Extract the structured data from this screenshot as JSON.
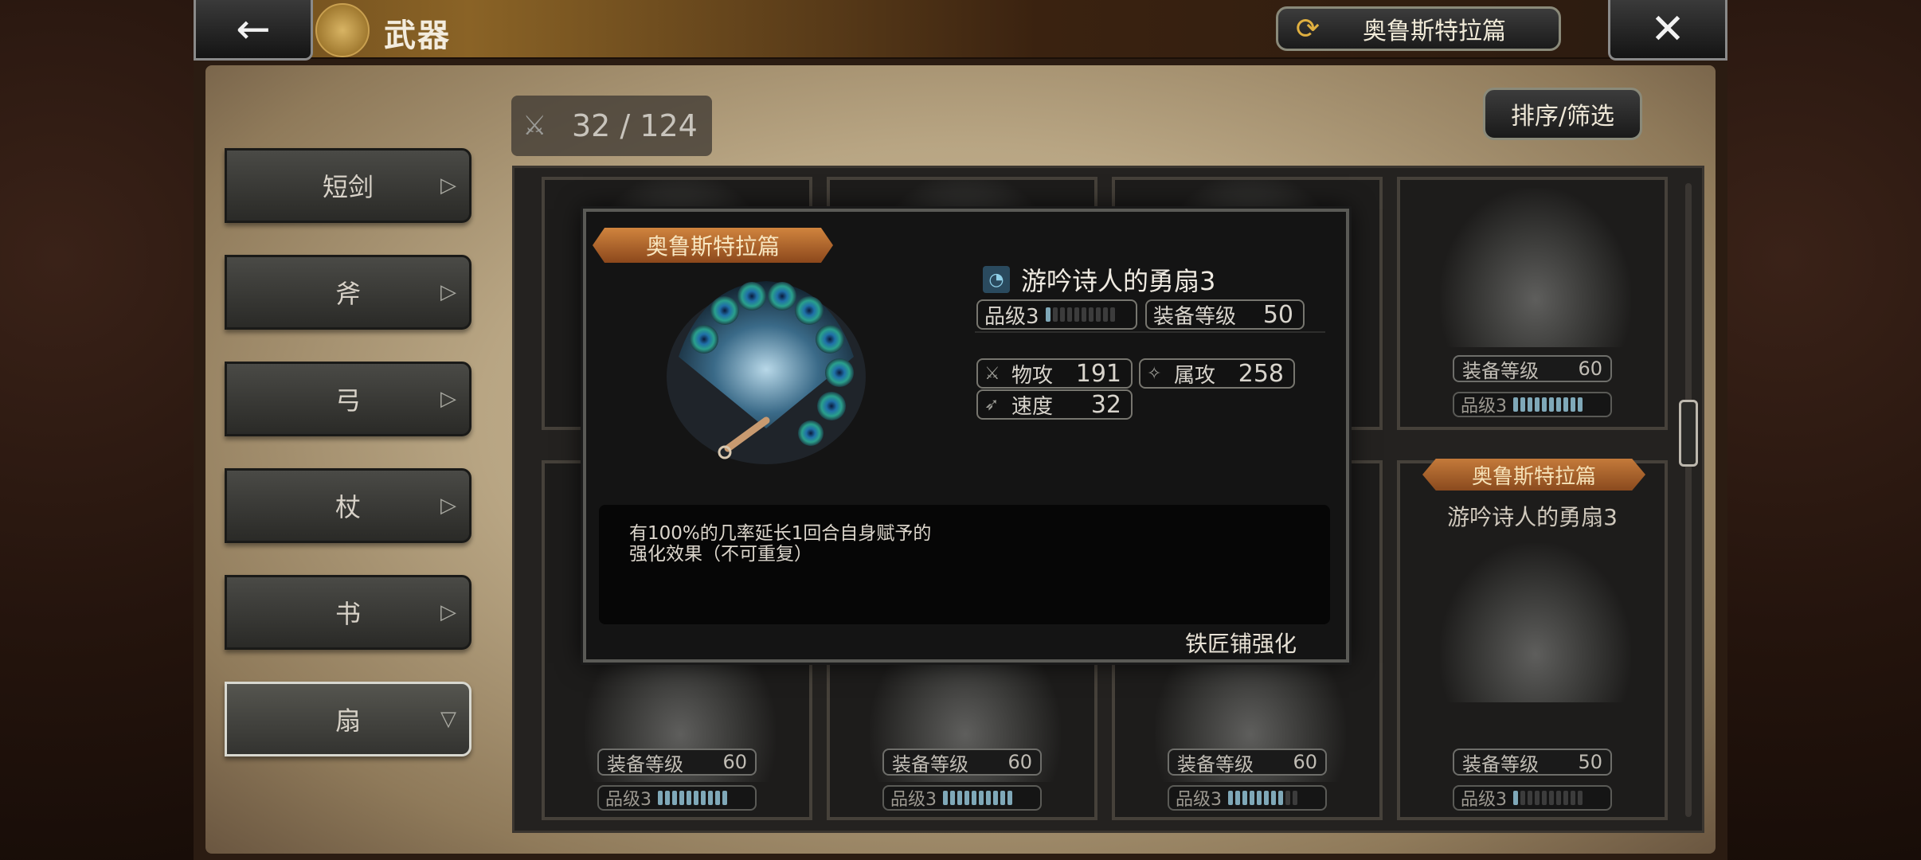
{
  "header": {
    "title": "武器",
    "chapter_label": "奥鲁斯特拉篇",
    "back_icon": "←",
    "close_icon": "✕"
  },
  "inventory": {
    "count": "32 / 124",
    "sort_label": "排序/筛选"
  },
  "categories": [
    {
      "label": "短剑",
      "arrow": "▷"
    },
    {
      "label": "斧",
      "arrow": "▷"
    },
    {
      "label": "弓",
      "arrow": "▷"
    },
    {
      "label": "杖",
      "arrow": "▷"
    },
    {
      "label": "书",
      "arrow": "▷"
    },
    {
      "label": "扇",
      "arrow": "▽",
      "active": true
    }
  ],
  "grid": {
    "top_right": {
      "equip_label": "装备等级",
      "equip_value": "60",
      "rank_label": "品级3",
      "rank_fill": 10
    },
    "right_featured": {
      "banner": "奥鲁斯特拉篇",
      "name": "游吟诗人的勇扇3"
    },
    "bottom_row": [
      {
        "equip_label": "装备等级",
        "equip_value": "60",
        "rank_label": "品级3",
        "rank_fill": 10
      },
      {
        "equip_label": "装备等级",
        "equip_value": "60",
        "rank_label": "品级3",
        "rank_fill": 10
      },
      {
        "equip_label": "装备等级",
        "equip_value": "60",
        "rank_label": "品级3",
        "rank_fill": 8
      },
      {
        "equip_label": "装备等级",
        "equip_value": "50",
        "rank_label": "品级3",
        "rank_fill": 1
      }
    ]
  },
  "popup": {
    "banner": "奥鲁斯特拉篇",
    "item_name": "游吟诗人的勇扇3",
    "rank_label": "品级3",
    "rank_fill": 1,
    "equip_label": "装备等级",
    "equip_value": "50",
    "stats": {
      "phys_label": "物攻",
      "phys_value": "191",
      "elem_label": "属攻",
      "elem_value": "258",
      "speed_label": "速度",
      "speed_value": "32"
    },
    "description_line1": "有100%的几率延长1回合自身赋予的",
    "description_line2": "强化效果（不可重复）",
    "smith_link": "铁匠铺强化"
  },
  "colors": {
    "banner": "#c47a3a",
    "rank_bar_on": "#7fa8b8",
    "accent_gold": "#e0b040"
  }
}
